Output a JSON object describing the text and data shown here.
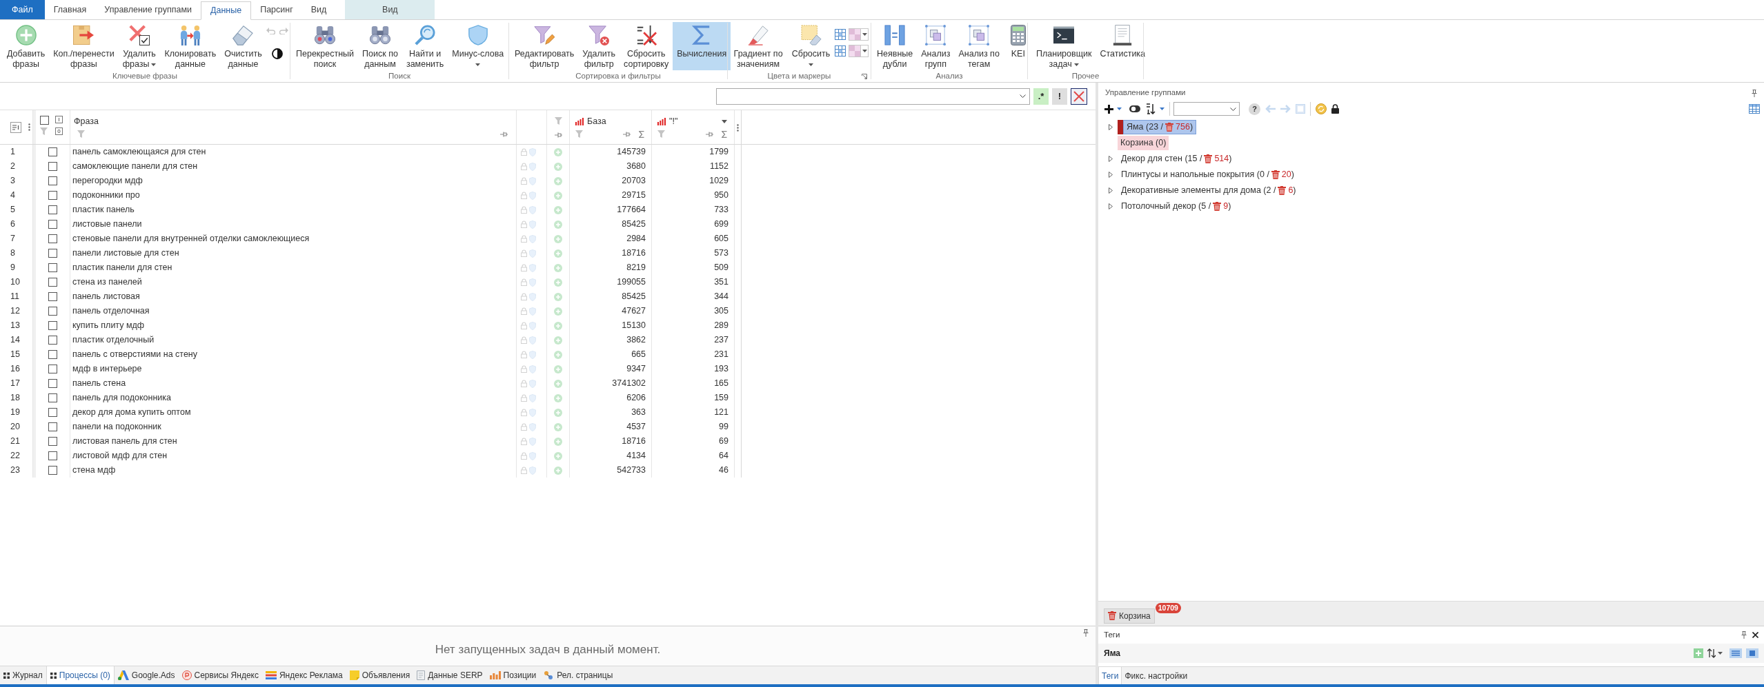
{
  "menu_tabs": [
    {
      "label": "Файл",
      "kind": "file",
      "selected": false
    },
    {
      "label": "Главная",
      "kind": "tab",
      "selected": false
    },
    {
      "label": "Управление группами",
      "kind": "tab",
      "selected": false
    },
    {
      "label": "Данные",
      "kind": "tab",
      "selected": true
    },
    {
      "label": "Парсинг",
      "kind": "tab",
      "selected": false
    },
    {
      "label": "Вид",
      "kind": "tab",
      "selected": false
    },
    {
      "label": "Вид",
      "kind": "context",
      "selected": false
    }
  ],
  "ribbon": [
    {
      "label": "Ключевые фразы",
      "launcher": false,
      "items": [
        {
          "kind": "large",
          "label": "Добавить фразы",
          "dropdown": false,
          "pressed": false
        },
        {
          "kind": "large",
          "label": "Коп./перенести фразы",
          "dropdown": false,
          "pressed": false
        },
        {
          "kind": "large",
          "label": "Удалить фразы",
          "dropdown": true,
          "pressed": false
        },
        {
          "kind": "large",
          "label": "Клонировать данные",
          "dropdown": false,
          "pressed": false
        },
        {
          "kind": "large",
          "label": "Очистить данные",
          "dropdown": false,
          "pressed": false
        },
        {
          "kind": "history",
          "disabled": true
        }
      ]
    },
    {
      "label": "Поиск",
      "launcher": false,
      "items": [
        {
          "kind": "large",
          "label": "Перекрестный поиск",
          "dropdown": false,
          "pressed": false
        },
        {
          "kind": "large",
          "label": "Поиск по данным",
          "dropdown": false,
          "pressed": false
        },
        {
          "kind": "large",
          "label": "Найти и заменить",
          "dropdown": false,
          "pressed": false
        },
        {
          "kind": "large",
          "label": "Минус-слова",
          "dropdown": true,
          "pressed": false
        }
      ]
    },
    {
      "label": "Сортировка и фильтры",
      "launcher": false,
      "items": [
        {
          "kind": "large",
          "label": "Редактировать фильтр",
          "dropdown": false,
          "pressed": false
        },
        {
          "kind": "large",
          "label": "Удалить фильтр",
          "dropdown": false,
          "pressed": false
        },
        {
          "kind": "large",
          "label": "Сбросить сортировку",
          "dropdown": false,
          "pressed": false
        },
        {
          "kind": "large",
          "label": "Вычисления",
          "dropdown": false,
          "pressed": true
        }
      ]
    },
    {
      "label": "Цвета и маркеры",
      "launcher": true,
      "items": [
        {
          "kind": "large",
          "label": "Градиент по значениям",
          "dropdown": false,
          "pressed": false
        },
        {
          "kind": "large",
          "label": "Сбросить",
          "dropdown": true,
          "pressed": false
        },
        {
          "kind": "gallery"
        }
      ]
    },
    {
      "label": "Анализ",
      "launcher": false,
      "items": [
        {
          "kind": "large",
          "label": "Неявные дубли",
          "dropdown": false,
          "pressed": false
        },
        {
          "kind": "large",
          "label": "Анализ групп",
          "dropdown": false,
          "pressed": false
        },
        {
          "kind": "large",
          "label": "Анализ по тегам",
          "dropdown": false,
          "pressed": false
        },
        {
          "kind": "large",
          "label": "KEI",
          "dropdown": false,
          "pressed": false
        }
      ]
    },
    {
      "label": "Прочее",
      "launcher": false,
      "items": [
        {
          "kind": "large",
          "label": "Планировщик задач",
          "dropdown": true,
          "pressed": false
        },
        {
          "kind": "large",
          "label": "Статистика",
          "dropdown": false,
          "pressed": false
        }
      ]
    }
  ],
  "filter_bar": {
    "buttons": [
      {
        "kind": "regex",
        "label": ".*"
      },
      {
        "kind": "exclude",
        "label": "!"
      },
      {
        "kind": "clear"
      }
    ]
  },
  "table": {
    "all_checked": false,
    "check_toggles": [
      "I",
      "0"
    ],
    "columns": [
      {
        "label": "Фраза",
        "kind": "text",
        "sorted": false
      },
      {
        "label": "База",
        "kind": "metric",
        "sorted": false
      },
      {
        "label": "\"!\"",
        "kind": "metric",
        "sorted": true
      }
    ],
    "rows": [
      {
        "number": "1",
        "checked": false,
        "phrase": "панель самоклеющаяся для стен",
        "values": [
          "145739",
          "1799"
        ]
      },
      {
        "number": "2",
        "checked": false,
        "phrase": "самоклеющие панели для стен",
        "values": [
          "3680",
          "1152"
        ]
      },
      {
        "number": "3",
        "checked": false,
        "phrase": "перегородки мдф",
        "values": [
          "20703",
          "1029"
        ]
      },
      {
        "number": "4",
        "checked": false,
        "phrase": "подоконники про",
        "values": [
          "29715",
          "950"
        ]
      },
      {
        "number": "5",
        "checked": false,
        "phrase": "пластик панель",
        "values": [
          "177664",
          "733"
        ]
      },
      {
        "number": "6",
        "checked": false,
        "phrase": "листовые панели",
        "values": [
          "85425",
          "699"
        ]
      },
      {
        "number": "7",
        "checked": false,
        "phrase": "стеновые панели для внутренней отделки самоклеющиеся",
        "values": [
          "2984",
          "605"
        ]
      },
      {
        "number": "8",
        "checked": false,
        "phrase": "панели листовые для стен",
        "values": [
          "18716",
          "573"
        ]
      },
      {
        "number": "9",
        "checked": false,
        "phrase": "пластик панели для стен",
        "values": [
          "8219",
          "509"
        ]
      },
      {
        "number": "10",
        "checked": false,
        "phrase": "стена из панелей",
        "values": [
          "199055",
          "351"
        ]
      },
      {
        "number": "11",
        "checked": false,
        "phrase": "панель листовая",
        "values": [
          "85425",
          "344"
        ]
      },
      {
        "number": "12",
        "checked": false,
        "phrase": "панель отделочная",
        "values": [
          "47627",
          "305"
        ]
      },
      {
        "number": "13",
        "checked": false,
        "phrase": "купить плиту мдф",
        "values": [
          "15130",
          "289"
        ]
      },
      {
        "number": "14",
        "checked": false,
        "phrase": "пластик отделочный",
        "values": [
          "3862",
          "237"
        ]
      },
      {
        "number": "15",
        "checked": false,
        "phrase": "панель с отверстиями на стену",
        "values": [
          "665",
          "231"
        ]
      },
      {
        "number": "16",
        "checked": false,
        "phrase": "мдф в интерьере",
        "values": [
          "9347",
          "193"
        ]
      },
      {
        "number": "17",
        "checked": false,
        "phrase": "панель стена",
        "values": [
          "3741302",
          "165"
        ]
      },
      {
        "number": "18",
        "checked": false,
        "phrase": "панель для подоконника",
        "values": [
          "6206",
          "159"
        ]
      },
      {
        "number": "19",
        "checked": false,
        "phrase": "декор для дома купить оптом",
        "values": [
          "363",
          "121"
        ]
      },
      {
        "number": "20",
        "checked": false,
        "phrase": "панели на подоконник",
        "values": [
          "4537",
          "99"
        ]
      },
      {
        "number": "21",
        "checked": false,
        "phrase": "листовая панель для стен",
        "values": [
          "18716",
          "69"
        ]
      },
      {
        "number": "22",
        "checked": false,
        "phrase": "листовой мдф для стен",
        "values": [
          "4134",
          "64"
        ]
      },
      {
        "number": "23",
        "checked": false,
        "phrase": "стена мдф",
        "values": [
          "542733",
          "46"
        ]
      }
    ]
  },
  "processes": {
    "message": "Нет запущенных задач в данный момент."
  },
  "bottom_tabs": [
    {
      "label": "Журнал",
      "selected": false
    },
    {
      "label": "Процессы (0)",
      "selected": true
    },
    {
      "label": "Google.Ads",
      "selected": false
    },
    {
      "label": "Сервисы Яндекс",
      "selected": false
    },
    {
      "label": "Яндекс Реклама",
      "selected": false
    },
    {
      "label": "Объявления",
      "selected": false
    },
    {
      "label": "Данные SERP",
      "selected": false
    },
    {
      "label": "Позиции",
      "selected": false
    },
    {
      "label": "Рел. страницы",
      "selected": false
    }
  ],
  "groups_panel": {
    "title": "Управление группами",
    "toolbar": [
      {
        "kind": "add",
        "dropdown": true
      },
      {
        "kind": "toggle"
      },
      {
        "kind": "sort",
        "dropdown": true
      },
      {
        "kind": "separator"
      },
      {
        "kind": "select"
      },
      {
        "kind": "help",
        "label": "?"
      },
      {
        "kind": "back",
        "disabled": true
      },
      {
        "kind": "forward",
        "disabled": true
      },
      {
        "kind": "save",
        "disabled": true
      },
      {
        "kind": "separator"
      },
      {
        "kind": "refresh"
      },
      {
        "kind": "lock"
      },
      {
        "kind": "grid"
      }
    ],
    "tree": [
      {
        "kind": "group",
        "label": "Яма (23 /",
        "deleted": "756",
        "suffix": ")",
        "color": "#b0201e",
        "selected": true,
        "expandable": true,
        "children": [
          {
            "kind": "bin",
            "label": "Корзина (0)",
            "selected": false,
            "expandable": false
          }
        ]
      },
      {
        "kind": "group",
        "label": "Декор для стен (15 /",
        "deleted": "514",
        "suffix": ")",
        "selected": false,
        "expandable": true
      },
      {
        "kind": "group",
        "label": "Плинтусы и напольные покрытия (0 /",
        "deleted": "20",
        "suffix": ")",
        "selected": false,
        "expandable": true
      },
      {
        "kind": "group",
        "label": "Декоративные элементы для дома (2 /",
        "deleted": "6",
        "suffix": ")",
        "selected": false,
        "expandable": true
      },
      {
        "kind": "group",
        "label": "Потолочный декор (5 /",
        "deleted": "9",
        "suffix": ")",
        "selected": false,
        "expandable": true
      }
    ],
    "bin": {
      "label": "Корзина",
      "badge": "10709"
    }
  },
  "tags_panel": {
    "title": "Теги",
    "group": "Яма",
    "toolbar": [
      {
        "kind": "add"
      },
      {
        "kind": "sort",
        "dropdown": true
      },
      {
        "kind": "list"
      },
      {
        "kind": "tiles"
      }
    ],
    "tabs": [
      {
        "label": "Теги",
        "selected": true
      },
      {
        "label": "Фикс. настройки",
        "selected": false
      }
    ]
  }
}
